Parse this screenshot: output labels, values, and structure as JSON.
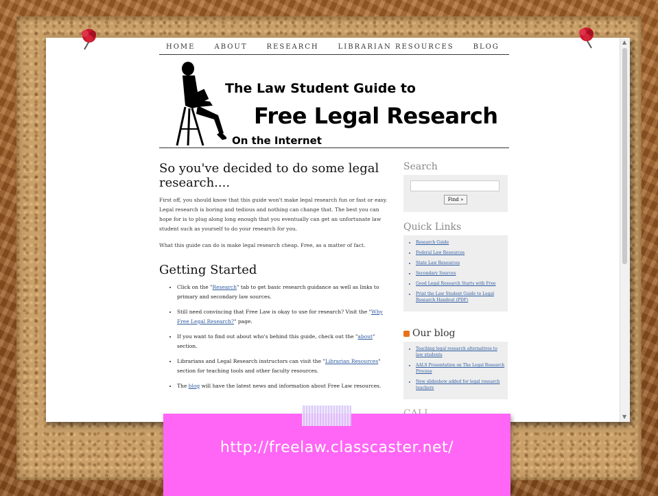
{
  "nav": [
    "HOME",
    "ABOUT",
    "RESEARCH",
    "LIBRARIAN RESOURCES",
    "BLOG"
  ],
  "header": {
    "line1": "The Law Student Guide to",
    "line2": "Free Legal Research",
    "line3": "On the Internet"
  },
  "main": {
    "title": "So you've decided to do some legal research....",
    "para1": "First off, you should know that this guide won't make legal research fun or fast or easy. Legal research is boring and tedious and nothing can change that. The best you can hope for is to plug along long enough that you eventually can get an unfortunate law student such as yourself to do your research for you.",
    "para2": "What this guide can do is make legal research cheap. Free, as a matter of fact.",
    "getting_started": "Getting Started",
    "items": [
      {
        "pre": "Click on the \"",
        "link": "Research",
        "post": "\" tab to get basic research guidance as well as links to primary and secondary law sources."
      },
      {
        "pre": "Still need convincing that Free Law is okay to use for research? Visit the \"",
        "link": "Why Free Legal Research?",
        "post": "\" page."
      },
      {
        "pre": "If you want to find out about who's behind this guide, check out the \"",
        "link": "about",
        "post": "\" section."
      },
      {
        "pre": "Librarians and Legal Research instructors can visit the \"",
        "link": "Librarian Resources",
        "post": "\" section for teaching tools and other faculty resources."
      },
      {
        "pre": "The ",
        "link": "blog",
        "post": " will have the latest news and information about Free Law resources."
      }
    ]
  },
  "sidebar": {
    "search_heading": "Search",
    "find_label": "Find »",
    "quick_heading": "Quick Links",
    "quick_links": [
      "Research Guide",
      "Federal Law Resources",
      "State Law Resources",
      "Secondary Sources",
      "Good Legal Research Starts with Free",
      "Print the Law Student Guide to Legal Research Handout (PDF)"
    ],
    "blog_heading": "Our blog",
    "blog_links": [
      "Teaching legal research alternatives to law students",
      "AALS Presentation on The Legal Research Process",
      "New slideshow added for legal research teachers"
    ],
    "partial_heading": "CALI"
  },
  "caption": "http://freelaw.classcaster.net/",
  "colors": {
    "caption_bg": "#ff66f5",
    "link": "#2c5aa0",
    "frame": "#a9652b"
  }
}
